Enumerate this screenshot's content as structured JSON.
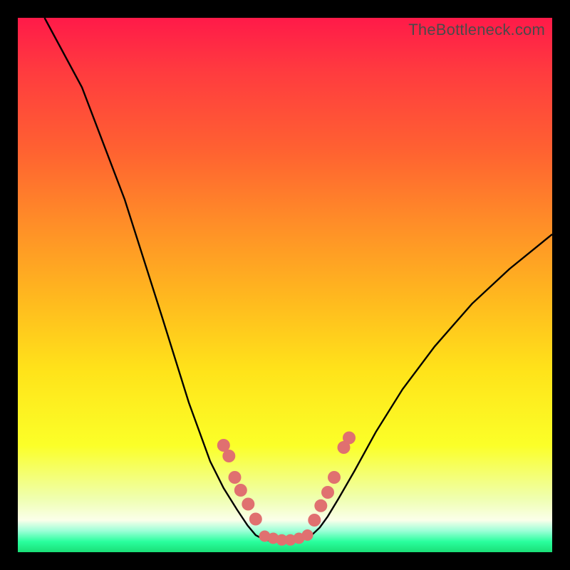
{
  "watermark": "TheBottleneck.com",
  "colors": {
    "frame": "#000000",
    "marker": "#e07070",
    "curve": "#000000"
  },
  "chart_data": {
    "type": "line",
    "title": "",
    "xlabel": "",
    "ylabel": "",
    "xlim": [
      0,
      100
    ],
    "ylim": [
      0,
      100
    ],
    "curve": [
      {
        "x": 5,
        "y": 100
      },
      {
        "x": 12,
        "y": 87
      },
      {
        "x": 20,
        "y": 66
      },
      {
        "x": 27,
        "y": 44
      },
      {
        "x": 32,
        "y": 28
      },
      {
        "x": 36,
        "y": 17
      },
      {
        "x": 38.5,
        "y": 12
      },
      {
        "x": 41,
        "y": 8
      },
      {
        "x": 43,
        "y": 5
      },
      {
        "x": 44.5,
        "y": 3.2
      },
      {
        "x": 46,
        "y": 2.4
      },
      {
        "x": 47.5,
        "y": 2.1
      },
      {
        "x": 49,
        "y": 2.0
      },
      {
        "x": 50.5,
        "y": 2.0
      },
      {
        "x": 52,
        "y": 2.1
      },
      {
        "x": 53.5,
        "y": 2.5
      },
      {
        "x": 55,
        "y": 3.2
      },
      {
        "x": 56.5,
        "y": 4.6
      },
      {
        "x": 58,
        "y": 6.7
      },
      {
        "x": 60,
        "y": 10.0
      },
      {
        "x": 63,
        "y": 15.2
      },
      {
        "x": 67,
        "y": 22.5
      },
      {
        "x": 72,
        "y": 30.5
      },
      {
        "x": 78,
        "y": 38.5
      },
      {
        "x": 85,
        "y": 46.5
      },
      {
        "x": 92,
        "y": 53.0
      },
      {
        "x": 100,
        "y": 59.5
      }
    ],
    "markers_left": [
      {
        "x": 38.5,
        "y": 20.0
      },
      {
        "x": 39.5,
        "y": 18.0
      },
      {
        "x": 40.6,
        "y": 14.0
      },
      {
        "x": 41.7,
        "y": 11.6
      },
      {
        "x": 43.1,
        "y": 9.0
      },
      {
        "x": 44.5,
        "y": 6.2
      }
    ],
    "markers_right": [
      {
        "x": 55.5,
        "y": 6.0
      },
      {
        "x": 56.7,
        "y": 8.7
      },
      {
        "x": 58.0,
        "y": 11.2
      },
      {
        "x": 59.2,
        "y": 14.0
      },
      {
        "x": 61.0,
        "y": 19.6
      },
      {
        "x": 62.0,
        "y": 21.4
      }
    ],
    "markers_bottom": [
      {
        "x": 46.2,
        "y": 3.0
      },
      {
        "x": 47.8,
        "y": 2.6
      },
      {
        "x": 49.4,
        "y": 2.3
      },
      {
        "x": 51.0,
        "y": 2.3
      },
      {
        "x": 52.6,
        "y": 2.6
      },
      {
        "x": 54.2,
        "y": 3.2
      }
    ]
  }
}
